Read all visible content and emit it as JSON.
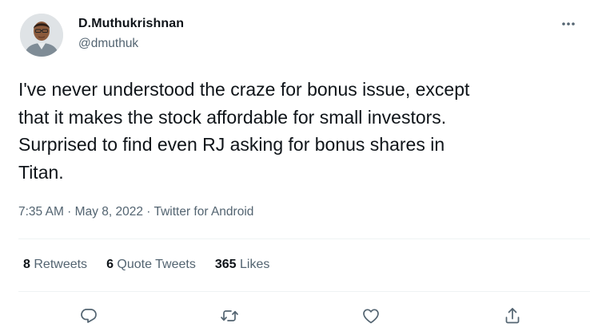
{
  "author": {
    "display_name": "D.Muthukrishnan",
    "handle": "@dmuthuk",
    "avatar_icon": "avatar-photo"
  },
  "tweet": {
    "text": "I've never understood the craze for bonus issue, except\nthat it makes the stock affordable for small investors.\nSurprised to find even RJ asking for bonus shares in\nTitan."
  },
  "meta": {
    "time": "7:35 AM",
    "separator": " · ",
    "date": "May 8, 2022",
    "source": "Twitter for Android"
  },
  "stats": {
    "retweets_count": "8",
    "retweets_label": "Retweets",
    "quotes_count": "6",
    "quotes_label": "Quote Tweets",
    "likes_count": "365",
    "likes_label": "Likes"
  },
  "actions": {
    "reply_icon": "reply-icon",
    "retweet_icon": "retweet-icon",
    "like_icon": "like-icon",
    "share_icon": "share-icon",
    "more_icon": "more-icon"
  },
  "colors": {
    "primary_text": "#0f1419",
    "secondary_text": "#536471",
    "divider": "#eff3f4"
  }
}
